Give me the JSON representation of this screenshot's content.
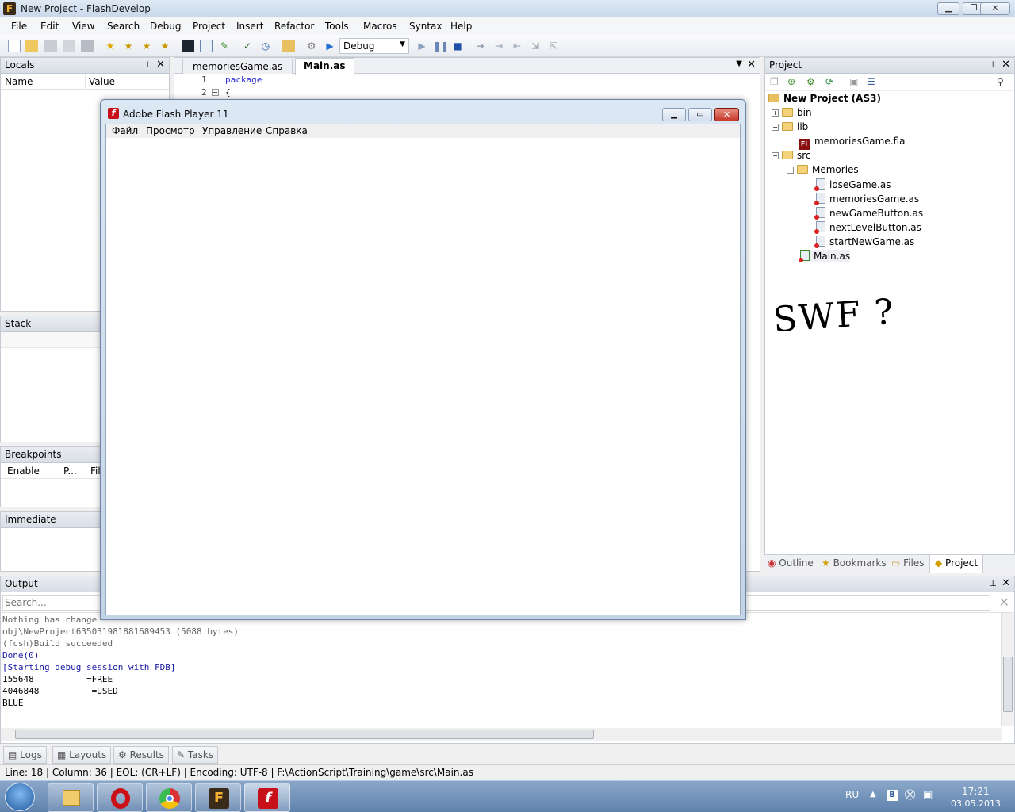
{
  "window": {
    "title": "New Project - FlashDevelop",
    "app_icon": "flashdevelop-icon"
  },
  "menu": [
    "File",
    "Edit",
    "View",
    "Search",
    "Debug",
    "Project",
    "Insert",
    "Refactor",
    "Tools",
    "Macros",
    "Syntax",
    "Help"
  ],
  "toolbar": {
    "config": "Debug"
  },
  "locals": {
    "title": "Locals",
    "col_name": "Name",
    "col_value": "Value"
  },
  "stack": {
    "title": "Stack"
  },
  "breakpoints": {
    "title": "Breakpoints",
    "col_enable": "Enable",
    "col_p": "P...",
    "col_file": "Fil"
  },
  "immediate": {
    "title": "Immediate"
  },
  "editor": {
    "tabs": [
      "memoriesGame.as",
      "Main.as"
    ],
    "active_tab": "Main.as",
    "lines": [
      {
        "num": "1",
        "text": "package"
      },
      {
        "num": "2",
        "text": "{"
      }
    ]
  },
  "flash_player": {
    "title": "Adobe Flash Player 11",
    "menu": [
      "Файл",
      "Просмотр",
      "Управление",
      "Справка"
    ]
  },
  "project": {
    "title": "Project",
    "root": "New Project (AS3)",
    "tree": [
      "bin",
      "lib",
      "memoriesGame.fla",
      "src",
      "Memories",
      "loseGame.as",
      "memoriesGame.as",
      "newGameButton.as",
      "nextLevelButton.as",
      "startNewGame.as",
      "Main.as"
    ],
    "annotation": "SWF ?",
    "tabs": [
      "Outline",
      "Bookmarks",
      "Files",
      "Project"
    ]
  },
  "output": {
    "title": "Output",
    "search_placeholder": "Search...",
    "lines": [
      "Nothing has change",
      "obj\\NewProject635031981881689453 (5088 bytes)",
      "(fcsh)Build succeeded",
      "Done(0)",
      "[Starting debug session with FDB]",
      "155648          =FREE",
      "4046848          =USED",
      "BLUE"
    ]
  },
  "bottom_tabs": [
    "Logs",
    "Layouts",
    "Results",
    "Tasks"
  ],
  "status": {
    "line": "Line: 18",
    "column": "Column: 36",
    "eol": "EOL: (CR+LF)",
    "encoding": "Encoding: UTF-8",
    "path": "F:\\ActionScript\\Training\\game\\src\\Main.as"
  },
  "taskbar": {
    "lang": "RU",
    "time": "17:21",
    "date": "03.05.2013"
  },
  "colors": {
    "keyword": "#2b2bd6",
    "output_blue": "#1a1aa6",
    "flash_red": "#c8101a"
  }
}
